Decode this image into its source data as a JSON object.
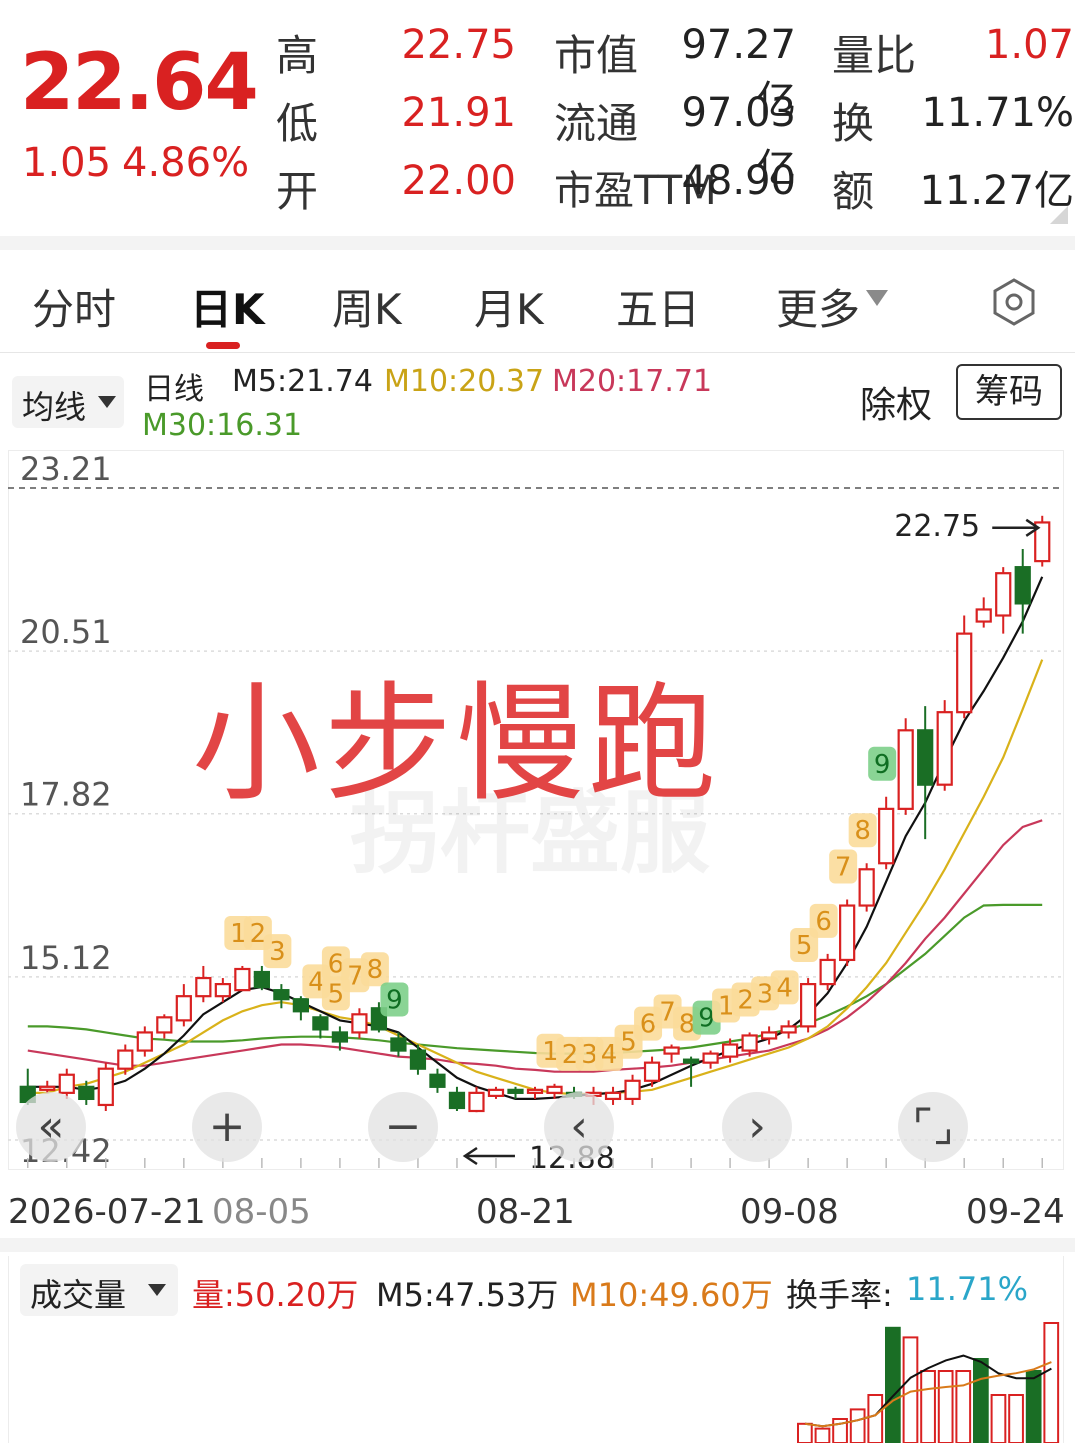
{
  "quote": {
    "price": "22.64",
    "change": "1.05",
    "change_pct": "4.86%",
    "rows": [
      {
        "l1": "高",
        "v1": "22.75",
        "l2": "市值",
        "v2": "97.27亿",
        "l3": "量比",
        "v3": "1.07"
      },
      {
        "l1": "低",
        "v1": "21.91",
        "l2": "流通",
        "v2": "97.03亿",
        "l3": "换",
        "v3": "11.71%"
      },
      {
        "l1": "开",
        "v1": "22.00",
        "l2": "市盈TTM",
        "v2": "48.90",
        "l3": "额",
        "v3": "11.27亿"
      }
    ]
  },
  "tabs": [
    "分时",
    "日K",
    "周K",
    "月K",
    "五日",
    "更多"
  ],
  "active_tab": "日K",
  "toolbar": {
    "ma_dropdown": "均线",
    "period": "日线",
    "m5": "M5:21.74",
    "m10": "M10:20.37",
    "m20": "M20:17.71",
    "m30": "M30:16.31",
    "exright": "除权",
    "chips": "筹码"
  },
  "watermark_text": "小步慢跑",
  "controls": [
    "«",
    "+",
    "−",
    "‹",
    "›",
    "⌜⌟"
  ],
  "x_ticks": [
    "2026-07-21",
    "08-05",
    "08-21",
    "09-08",
    "09-24"
  ],
  "volume": {
    "dropdown": "成交量",
    "vol": "量:50.20万",
    "m5": "M5:47.53万",
    "m10": "M10:49.60万",
    "turnover_label": "换手率:",
    "turnover_value": "11.71%"
  },
  "colors": {
    "up": "#d92121",
    "down": "#1a6e25",
    "m5": "#111111",
    "m10": "#d9b21a",
    "m20": "#c8385a",
    "m30": "#4a9a2a"
  },
  "chart_data": {
    "type": "candlestick",
    "y_ticks": [
      23.21,
      20.51,
      17.82,
      15.12,
      12.42
    ],
    "ylim": [
      12.42,
      23.21
    ],
    "high_marker": "22.75",
    "low_marker": "12.88",
    "candles": [
      [
        13.3,
        13.05,
        13.6,
        13.0
      ],
      [
        13.3,
        13.3,
        13.4,
        13.2
      ],
      [
        13.2,
        13.5,
        13.6,
        13.1
      ],
      [
        13.3,
        13.1,
        13.4,
        13.0
      ],
      [
        13.0,
        13.6,
        13.7,
        12.9
      ],
      [
        13.6,
        13.9,
        14.0,
        13.5
      ],
      [
        13.9,
        14.2,
        14.3,
        13.8
      ],
      [
        14.2,
        14.45,
        14.5,
        14.1
      ],
      [
        14.4,
        14.8,
        15.0,
        14.3
      ],
      [
        14.8,
        15.1,
        15.3,
        14.7
      ],
      [
        14.8,
        15.0,
        15.1,
        14.7
      ],
      [
        14.9,
        15.25,
        15.3,
        14.9
      ],
      [
        15.2,
        14.95,
        15.3,
        14.9
      ],
      [
        14.9,
        14.75,
        15.0,
        14.6
      ],
      [
        14.75,
        14.55,
        14.8,
        14.4
      ],
      [
        14.45,
        14.25,
        14.5,
        14.1
      ],
      [
        14.2,
        14.05,
        14.3,
        13.9
      ],
      [
        14.2,
        14.5,
        14.6,
        14.1
      ],
      [
        14.6,
        14.25,
        14.7,
        14.2
      ],
      [
        14.1,
        13.9,
        14.2,
        13.8
      ],
      [
        13.9,
        13.6,
        14.0,
        13.5
      ],
      [
        13.5,
        13.3,
        13.6,
        13.2
      ],
      [
        13.2,
        12.95,
        13.3,
        12.9
      ],
      [
        12.9,
        13.2,
        13.3,
        12.88
      ],
      [
        13.15,
        13.25,
        13.3,
        13.1
      ],
      [
        13.25,
        13.2,
        13.3,
        13.1
      ],
      [
        13.2,
        13.25,
        13.3,
        13.1
      ],
      [
        13.2,
        13.3,
        13.35,
        13.1
      ],
      [
        13.2,
        13.15,
        13.3,
        13.1
      ],
      [
        13.15,
        13.2,
        13.3,
        13.0
      ],
      [
        13.1,
        13.2,
        13.3,
        13.0
      ],
      [
        13.1,
        13.4,
        13.5,
        13.0
      ],
      [
        13.4,
        13.7,
        13.8,
        13.3
      ],
      [
        13.85,
        13.95,
        14.0,
        13.7
      ],
      [
        13.75,
        13.7,
        13.8,
        13.3
      ],
      [
        13.7,
        13.85,
        13.9,
        13.6
      ],
      [
        13.8,
        14.0,
        14.1,
        13.7
      ],
      [
        13.9,
        14.15,
        14.2,
        13.8
      ],
      [
        14.1,
        14.2,
        14.3,
        14.0
      ],
      [
        14.2,
        14.3,
        14.4,
        14.1
      ],
      [
        14.3,
        15.0,
        15.1,
        14.2
      ],
      [
        15.0,
        15.4,
        15.5,
        14.9
      ],
      [
        15.4,
        16.3,
        16.4,
        15.3
      ],
      [
        16.3,
        16.9,
        17.0,
        16.2
      ],
      [
        17.0,
        17.9,
        18.1,
        16.9
      ],
      [
        17.9,
        19.2,
        19.4,
        17.8
      ],
      [
        19.2,
        18.3,
        19.6,
        17.4
      ],
      [
        18.3,
        19.5,
        19.7,
        18.2
      ],
      [
        19.5,
        20.8,
        21.1,
        19.4
      ],
      [
        21.0,
        21.2,
        21.4,
        20.9
      ],
      [
        21.1,
        21.8,
        21.9,
        20.8
      ],
      [
        21.9,
        21.3,
        22.2,
        20.8
      ],
      [
        22.0,
        22.64,
        22.75,
        21.91
      ]
    ],
    "m5": [
      13.3,
      13.3,
      13.3,
      13.25,
      13.3,
      13.4,
      13.6,
      13.85,
      14.15,
      14.5,
      14.7,
      14.9,
      14.95,
      14.85,
      14.7,
      14.55,
      14.4,
      14.35,
      14.3,
      14.2,
      13.95,
      13.7,
      13.45,
      13.3,
      13.2,
      13.1,
      13.1,
      13.12,
      13.15,
      13.18,
      13.2,
      13.25,
      13.35,
      13.5,
      13.65,
      13.78,
      13.9,
      14.0,
      14.1,
      14.25,
      14.5,
      14.85,
      15.35,
      15.95,
      16.7,
      17.45,
      18.0,
      18.7,
      19.35,
      19.85,
      20.4,
      21.0,
      21.74
    ],
    "m10": [
      13.2,
      13.2,
      13.3,
      13.35,
      13.45,
      13.55,
      13.7,
      13.85,
      14.0,
      14.2,
      14.4,
      14.55,
      14.65,
      14.7,
      14.65,
      14.55,
      14.45,
      14.4,
      14.3,
      14.15,
      14.0,
      13.85,
      13.7,
      13.55,
      13.45,
      13.35,
      13.25,
      13.2,
      13.18,
      13.18,
      13.2,
      13.22,
      13.25,
      13.35,
      13.45,
      13.55,
      13.65,
      13.75,
      13.85,
      13.95,
      14.1,
      14.3,
      14.6,
      14.95,
      15.35,
      15.85,
      16.35,
      16.9,
      17.5,
      18.1,
      18.75,
      19.55,
      20.37
    ],
    "m20": [
      13.9,
      13.85,
      13.8,
      13.75,
      13.7,
      13.65,
      13.65,
      13.7,
      13.75,
      13.8,
      13.85,
      13.9,
      13.95,
      14.0,
      14.0,
      13.98,
      13.95,
      13.9,
      13.85,
      13.8,
      13.78,
      13.75,
      13.7,
      13.68,
      13.65,
      13.6,
      13.58,
      13.55,
      13.55,
      13.55,
      13.58,
      13.6,
      13.62,
      13.65,
      13.7,
      13.75,
      13.8,
      13.85,
      13.9,
      14.0,
      14.1,
      14.25,
      14.45,
      14.7,
      15.0,
      15.35,
      15.75,
      16.1,
      16.5,
      16.9,
      17.3,
      17.6,
      17.71
    ],
    "m30": [
      14.3,
      14.3,
      14.28,
      14.25,
      14.2,
      14.15,
      14.1,
      14.08,
      14.05,
      14.05,
      14.05,
      14.07,
      14.1,
      14.12,
      14.13,
      14.13,
      14.12,
      14.1,
      14.07,
      14.03,
      14.0,
      13.97,
      13.94,
      13.92,
      13.9,
      13.88,
      13.86,
      13.85,
      13.85,
      13.85,
      13.86,
      13.88,
      13.9,
      13.92,
      13.95,
      14.0,
      14.05,
      14.1,
      14.18,
      14.25,
      14.35,
      14.48,
      14.63,
      14.8,
      15.0,
      15.25,
      15.5,
      15.8,
      16.1,
      16.3,
      16.31,
      16.31,
      16.31
    ],
    "seq_labels": [
      {
        "i": 13,
        "text": "3"
      },
      {
        "i": 11,
        "text": "1"
      },
      {
        "i": 12,
        "text": "2"
      },
      {
        "i": 15,
        "text": "4"
      },
      {
        "i": 16,
        "text": "5"
      },
      {
        "i": 16,
        "text": "6"
      },
      {
        "i": 17,
        "text": "7"
      },
      {
        "i": 18,
        "text": "8"
      },
      {
        "i": 19,
        "text": "9"
      },
      {
        "i": 27,
        "text": "1"
      },
      {
        "i": 28,
        "text": "2"
      },
      {
        "i": 29,
        "text": "3"
      },
      {
        "i": 30,
        "text": "4"
      },
      {
        "i": 31,
        "text": "5"
      },
      {
        "i": 32,
        "text": "6"
      },
      {
        "i": 33,
        "text": "7"
      },
      {
        "i": 34,
        "text": "8"
      },
      {
        "i": 35,
        "text": "9"
      },
      {
        "i": 36,
        "text": "1"
      },
      {
        "i": 37,
        "text": "2"
      },
      {
        "i": 38,
        "text": "3"
      },
      {
        "i": 39,
        "text": "4"
      },
      {
        "i": 40,
        "text": "5"
      },
      {
        "i": 41,
        "text": "6"
      },
      {
        "i": 42,
        "text": "7"
      },
      {
        "i": 43,
        "text": "8"
      },
      {
        "i": 44,
        "text": "9"
      }
    ],
    "volumes": [
      {
        "v": 8,
        "up": true
      },
      {
        "v": 6,
        "up": true
      },
      {
        "v": 10,
        "up": true
      },
      {
        "v": 14,
        "up": true
      },
      {
        "v": 20,
        "up": true
      },
      {
        "v": 48,
        "up": false
      },
      {
        "v": 44,
        "up": true
      },
      {
        "v": 30,
        "up": true
      },
      {
        "v": 30,
        "up": true
      },
      {
        "v": 30,
        "up": true
      },
      {
        "v": 35,
        "up": false
      },
      {
        "v": 20,
        "up": true
      },
      {
        "v": 20,
        "up": true
      },
      {
        "v": 30,
        "up": false
      },
      {
        "v": 50,
        "up": true
      }
    ]
  }
}
